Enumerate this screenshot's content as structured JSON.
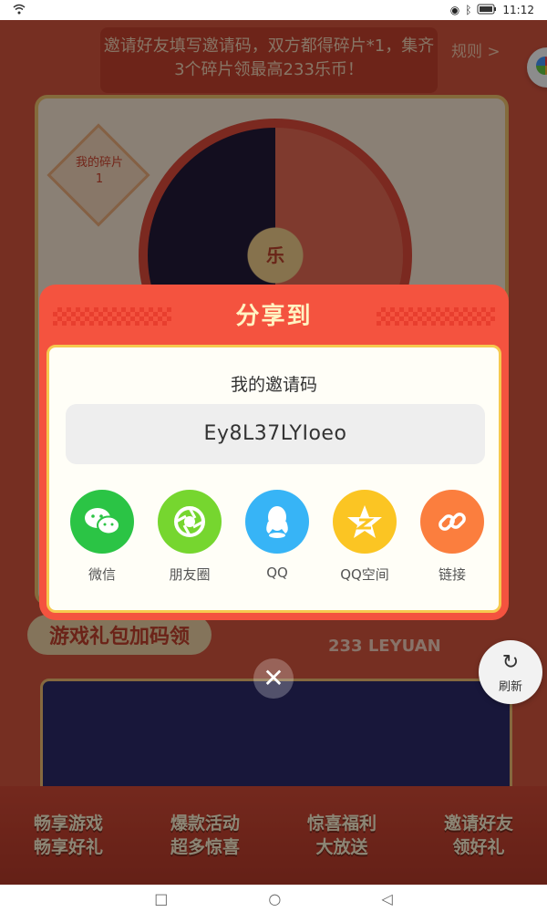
{
  "status": {
    "time": "11:12"
  },
  "background": {
    "banner": "邀请好友填写邀请码，双方都得碎片*1，集齐3个碎片领最高233乐币！",
    "rules_link": "规则 >",
    "shard_label": "我的碎片",
    "shard_count": "1",
    "wheel_center": "乐",
    "gifts_title": "游戏礼包加码领",
    "brand_text": "233 LEYUAN",
    "slogans": [
      "畅享游戏\n畅享好礼",
      "爆款活动\n超多惊喜",
      "惊喜福利\n大放送",
      "邀请好友\n领好礼"
    ]
  },
  "refresh": {
    "label": "刷新"
  },
  "dialog": {
    "title": "分享到",
    "code_label": "我的邀请码",
    "invite_code": "Ey8L37LYIoeo",
    "share_options": [
      {
        "label": "微信",
        "icon": "wechat-icon",
        "color": "#2bc445"
      },
      {
        "label": "朋友圈",
        "icon": "moments-icon",
        "color": "#76d62f"
      },
      {
        "label": "QQ",
        "icon": "qq-icon",
        "color": "#37b4f6"
      },
      {
        "label": "QQ空间",
        "icon": "qzone-icon",
        "color": "#fbc523"
      },
      {
        "label": "链接",
        "icon": "link-icon",
        "color": "#fb7e3e"
      }
    ]
  },
  "colors": {
    "dialog_red": "#f4533f",
    "body_border": "#f6c94f"
  }
}
